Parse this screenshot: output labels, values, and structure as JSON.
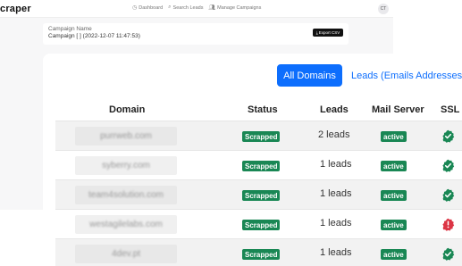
{
  "app": {
    "brand": "craper",
    "nav": [
      {
        "label": "Dashboard",
        "icon": "clock-icon"
      },
      {
        "label": "Search Leads",
        "icon": "search-icon"
      },
      {
        "label": "Manage Campaigns",
        "icon": "users-icon"
      }
    ],
    "avatar": "CT"
  },
  "campaign": {
    "label": "Campaign Name",
    "value": "Campaign [   ] (2022-12-07 11:47:53)",
    "export_label": "Export CSV"
  },
  "tabs": {
    "active": "All Domains",
    "inactive": "Leads (Emails Addresses)"
  },
  "table": {
    "headers": [
      "Domain",
      "Status",
      "Leads",
      "Mail Server",
      "SSL"
    ],
    "rows": [
      {
        "domain": "purrweb.com",
        "status": "Scrapped",
        "leads": "2 leads",
        "mail": "active",
        "ssl": "ok"
      },
      {
        "domain": "syberry.com",
        "status": "Scrapped",
        "leads": "1 leads",
        "mail": "active",
        "ssl": "ok"
      },
      {
        "domain": "team4solution.com",
        "status": "Scrapped",
        "leads": "1 leads",
        "mail": "active",
        "ssl": "ok"
      },
      {
        "domain": "westagilelabs.com",
        "status": "Scrapped",
        "leads": "1 leads",
        "mail": "active",
        "ssl": "error"
      },
      {
        "domain": "4dev.pt",
        "status": "Scrapped",
        "leads": "1 leads",
        "mail": "active",
        "ssl": "ok"
      }
    ]
  },
  "colors": {
    "primary": "#0d6efd",
    "success": "#198754",
    "danger": "#dc3545"
  }
}
